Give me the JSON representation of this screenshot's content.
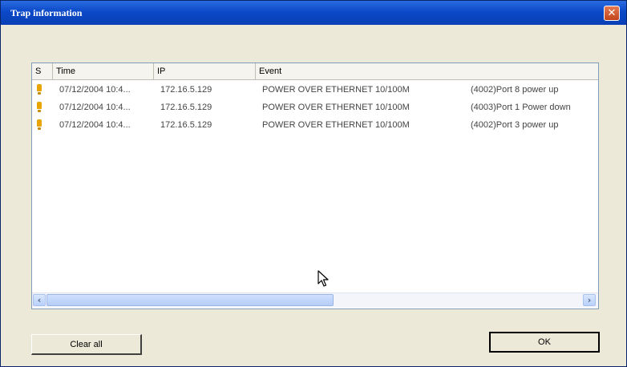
{
  "window": {
    "title": "Trap information",
    "close_glyph": "✕"
  },
  "list": {
    "columns": [
      "S",
      "Time",
      "IP",
      "Event"
    ],
    "rows": [
      {
        "status_icon": "warning-icon",
        "time": "07/12/2004 10:4...",
        "ip": "172.16.5.129",
        "event": "POWER OVER ETHERNET  10/100M",
        "detail": "(4002)Port 8 power up"
      },
      {
        "status_icon": "warning-icon",
        "time": "07/12/2004 10:4...",
        "ip": "172.16.5.129",
        "event": "POWER OVER ETHERNET  10/100M",
        "detail": "(4003)Port 1 Power down"
      },
      {
        "status_icon": "warning-icon",
        "time": "07/12/2004 10:4...",
        "ip": "172.16.5.129",
        "event": "POWER OVER ETHERNET  10/100M",
        "detail": "(4002)Port 3 power up"
      }
    ],
    "scrollbar": {
      "left_glyph": "‹",
      "right_glyph": "›"
    }
  },
  "buttons": {
    "clear_all": "Clear all",
    "ok": "OK"
  },
  "colors": {
    "title_bar": "#0b49c8",
    "warning": "#e8a400",
    "dialog_bg": "#ece9d8"
  }
}
